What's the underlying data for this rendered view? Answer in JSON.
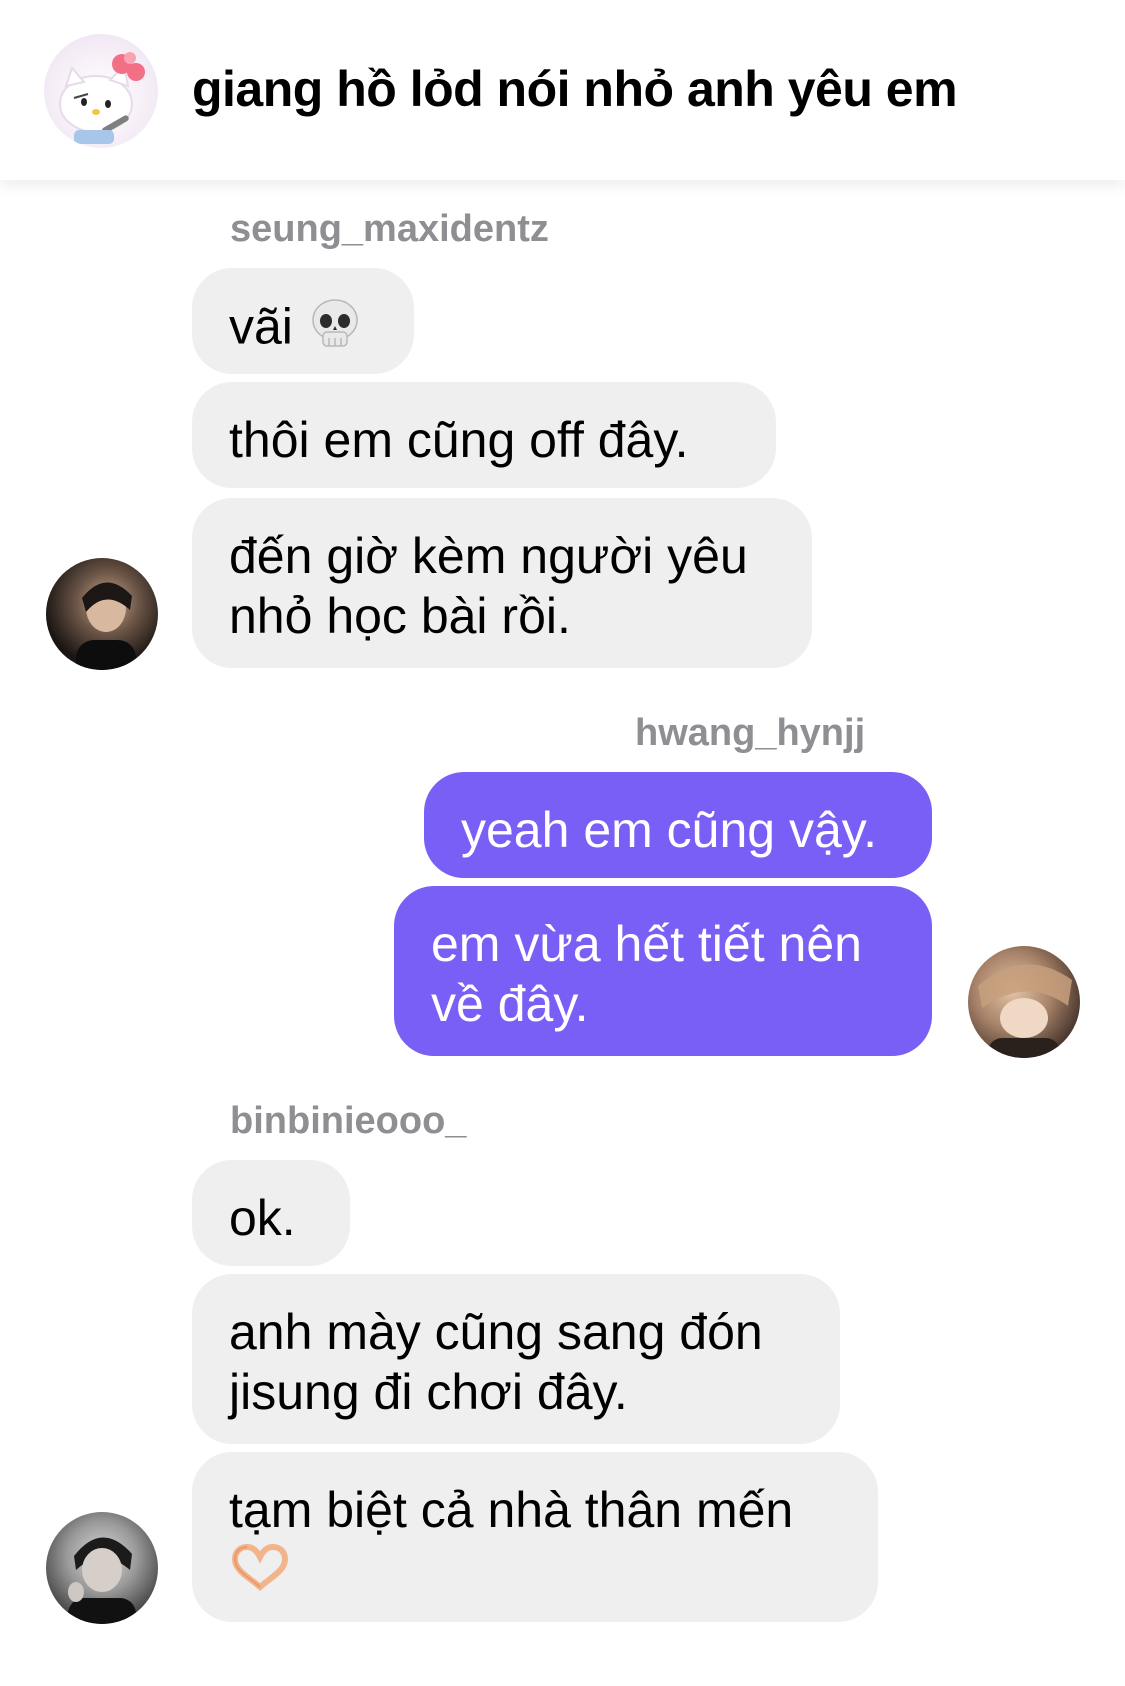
{
  "header": {
    "title": "giang hồ lỏd nói nhỏ anh yêu em",
    "avatar_icon": "hello-kitty-icon"
  },
  "colors": {
    "incoming_bubble": "#efefef",
    "outgoing_bubble": "#7a5ff6",
    "sender_name": "#8e8e93"
  },
  "groups": [
    {
      "sender": "seung_maxidentz",
      "messages": [
        {
          "text": "vãi",
          "emoji": "skull-icon"
        },
        {
          "text": "thôi em cũng off đây."
        },
        {
          "text": "đến giờ kèm người yêu nhỏ học bài rồi."
        }
      ]
    },
    {
      "sender": "hwang_hynjj",
      "messages": [
        {
          "text": "yeah em cũng vậy."
        },
        {
          "text": "em vừa hết tiết nên về đây."
        }
      ]
    },
    {
      "sender": "binbinieooo_",
      "messages": [
        {
          "text": "ok."
        },
        {
          "text": "anh mày cũng sang đón jisung đi chơi đây."
        },
        {
          "text": "tạm biệt cả nhà thân mến",
          "emoji": "heart-hands-icon"
        }
      ]
    }
  ]
}
